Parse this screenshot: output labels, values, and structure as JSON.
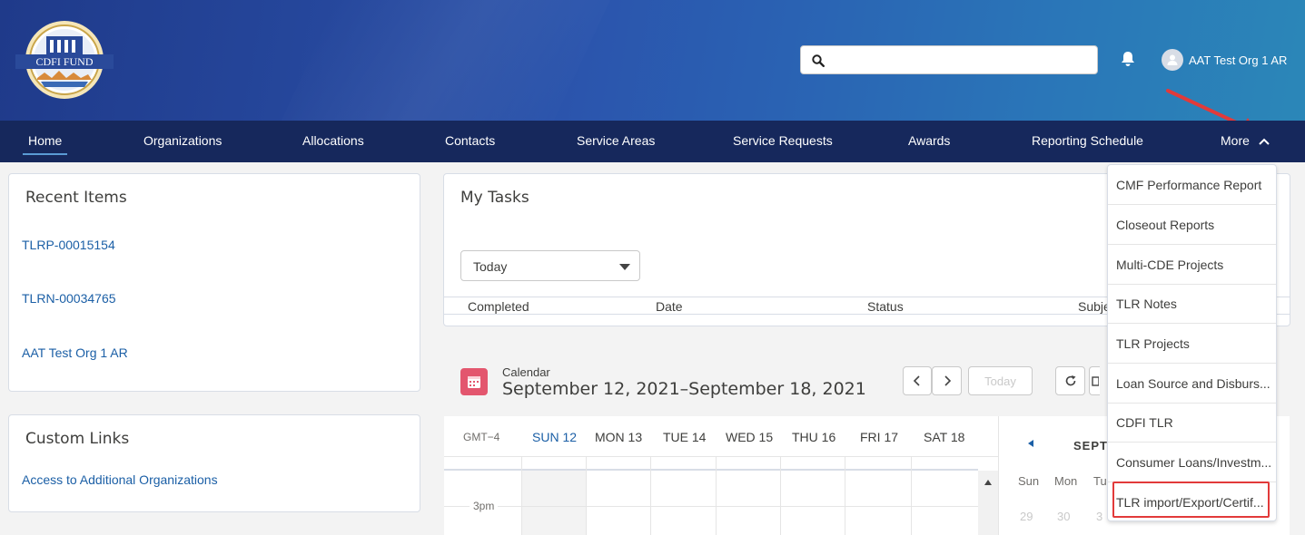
{
  "header": {
    "logo_text": "CDFI FUND",
    "search": {
      "value": "",
      "placeholder": ""
    },
    "user_name": "AAT Test Org 1 AR"
  },
  "nav": {
    "items": [
      {
        "label": "Home",
        "active": true
      },
      {
        "label": "Organizations"
      },
      {
        "label": "Allocations"
      },
      {
        "label": "Contacts"
      },
      {
        "label": "Service Areas"
      },
      {
        "label": "Service Requests"
      },
      {
        "label": "Awards"
      },
      {
        "label": "Reporting Schedule"
      }
    ],
    "more_label": "More"
  },
  "recent_items": {
    "title": "Recent Items",
    "items": [
      "TLRP-00015154",
      "TLRN-00034765",
      "AAT Test Org 1 AR"
    ]
  },
  "custom_links": {
    "title": "Custom Links",
    "items": [
      "Access to Additional Organizations"
    ]
  },
  "my_tasks": {
    "title": "My Tasks",
    "filter_value": "Today",
    "columns": [
      "Completed",
      "Date",
      "Status",
      "Subje"
    ]
  },
  "calendar": {
    "label": "Calendar",
    "range": "September 12, 2021–September 18, 2021",
    "today_button": "Today",
    "timezone": "GMT−4",
    "days": [
      "SUN 12",
      "MON 13",
      "TUE 14",
      "WED 15",
      "THU 16",
      "FRI 17",
      "SAT 18"
    ],
    "time_label": "3pm",
    "mini": {
      "month": "SEPTE",
      "weekdays": [
        "Sun",
        "Mon",
        "Tu"
      ],
      "dates": [
        "29",
        "30",
        "3"
      ]
    }
  },
  "more_menu": {
    "items": [
      "CMF Performance Report",
      "Closeout Reports",
      "Multi-CDE Projects",
      "TLR Notes",
      "TLR Projects",
      "Loan Source and Disburs...",
      "CDFI TLR",
      "Consumer Loans/Investm...",
      "TLR import/Export/Certif..."
    ],
    "highlighted_index": 8
  },
  "colors": {
    "nav_bg": "#16285c",
    "link": "#1b5fa6",
    "calendar_icon": "#e3566e",
    "highlight": "#e23a3a"
  }
}
